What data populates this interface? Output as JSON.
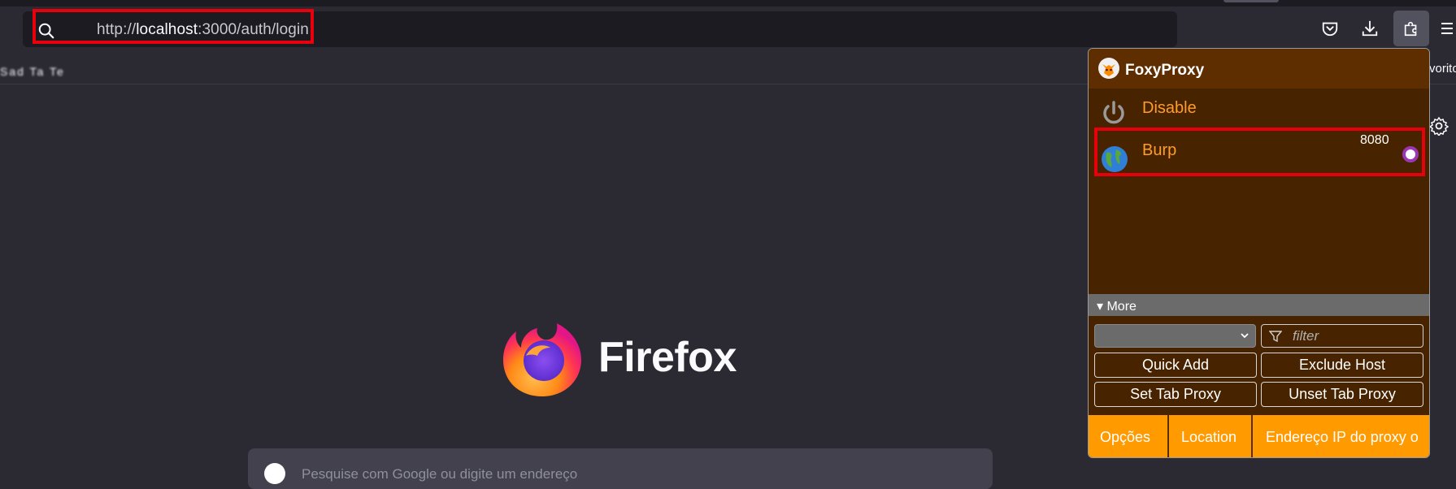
{
  "browser": {
    "url_prefix": "http://",
    "url_host": "localhost",
    "url_rest": ":3000/auth/login",
    "bookmarks_blurred": "Sad Ta Te",
    "bookmarks_right": "vorito"
  },
  "newtab": {
    "brand": "Firefox",
    "search_placeholder": "Pesquise com Google ou digite um endereço"
  },
  "foxyproxy": {
    "title": "FoxyProxy",
    "disable_label": "Disable",
    "proxy_name": "Burp",
    "proxy_port": "8080",
    "more_label": "▾ More",
    "select_value": "",
    "filter_placeholder": "filter",
    "buttons": {
      "quick_add": "Quick Add",
      "exclude_host": "Exclude Host",
      "set_tab_proxy": "Set Tab Proxy",
      "unset_tab_proxy": "Unset Tab Proxy"
    },
    "footer": {
      "options": "Opções",
      "location": "Location",
      "proxy_ip": "Endereço IP do proxy o"
    }
  },
  "colors": {
    "highlight": "#e8000b",
    "foxy_bg": "#482300",
    "foxy_accent": "#ff9d2b",
    "footer": "#ff9a00"
  }
}
